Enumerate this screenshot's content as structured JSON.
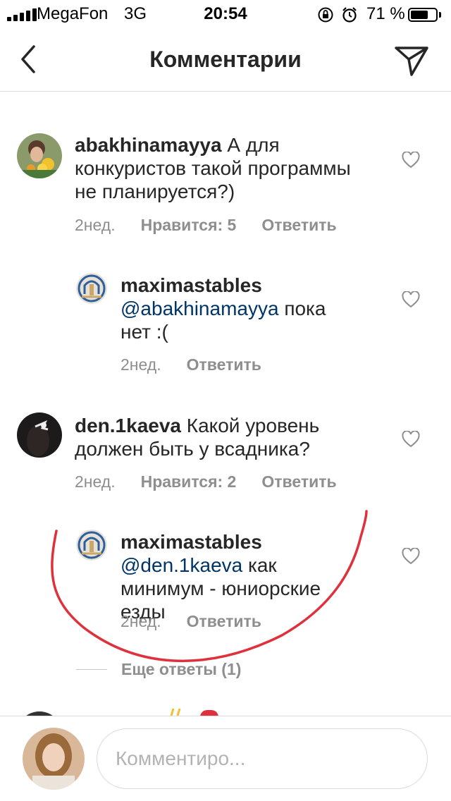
{
  "status_bar": {
    "carrier": "MegaFon",
    "network": "3G",
    "time": "20:54",
    "battery_percent": "71 %",
    "battery_level": 0.71
  },
  "header": {
    "title": "Комментарии",
    "back_icon": "chevron-left-icon",
    "send_icon": "paper-plane-icon"
  },
  "comments": [
    {
      "username": "abakhinamayya",
      "text": " А для конкуристов такой программы не планируется?)",
      "time": "2нед.",
      "likes": "Нравится: 5",
      "reply": "Ответить"
    },
    {
      "username": "maximastables",
      "mention": "@abakhinamayya",
      "text": " пока нет :(",
      "time": "2нед.",
      "reply": "Ответить"
    },
    {
      "username": "den.1kaeva",
      "text": " Какой уровень должен быть у всадника?",
      "time": "2нед.",
      "likes": "Нравится: 2",
      "reply": "Ответить"
    },
    {
      "username": "maximastables",
      "mention": "@den.1kaeva",
      "text": " как минимум - юниорские езды",
      "time": "2нед.",
      "reply": "Ответить"
    }
  ],
  "more_replies": "Еще ответы (1)",
  "composer": {
    "placeholder": "Комментиро..."
  },
  "colors": {
    "mention": "#003569",
    "meta": "#8e8e8e",
    "annotation": "#e0303c"
  }
}
